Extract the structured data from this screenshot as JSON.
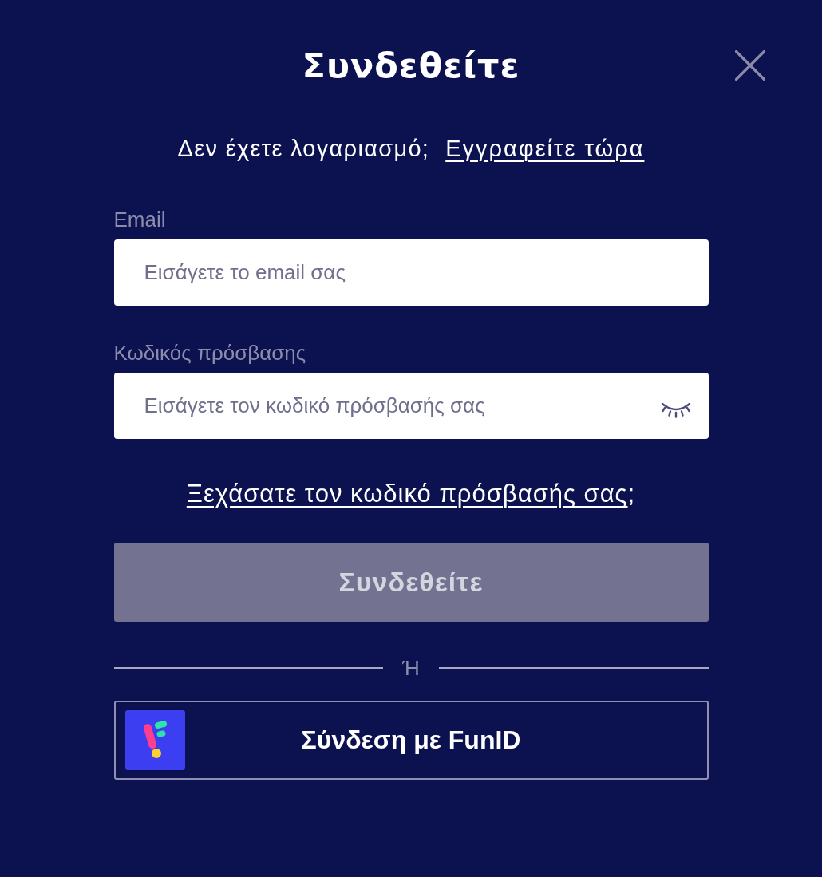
{
  "dialog": {
    "title": "Συνδεθείτε"
  },
  "signup_prompt": {
    "text": "Δεν έχετε λογαριασμό;",
    "link": "Εγγραφείτε τώρα"
  },
  "fields": [
    {
      "kind": "email",
      "label": "Email",
      "placeholder": "Εισάγετε το email σας"
    },
    {
      "kind": "password",
      "label": "Κωδικός πρόσβασης",
      "placeholder": "Εισάγετε τον κωδικό πρόσβασής σας",
      "password_visible": false
    }
  ],
  "forgot_password": {
    "link": "Ξεχάσατε τον κωδικό πρόσβασής σας",
    "suffix": ";"
  },
  "submit_button": {
    "label": "Συνδεθείτε",
    "disabled": true
  },
  "divider": {
    "text": "Ή"
  },
  "social_button": {
    "label": "Σύνδεση με FunID"
  }
}
